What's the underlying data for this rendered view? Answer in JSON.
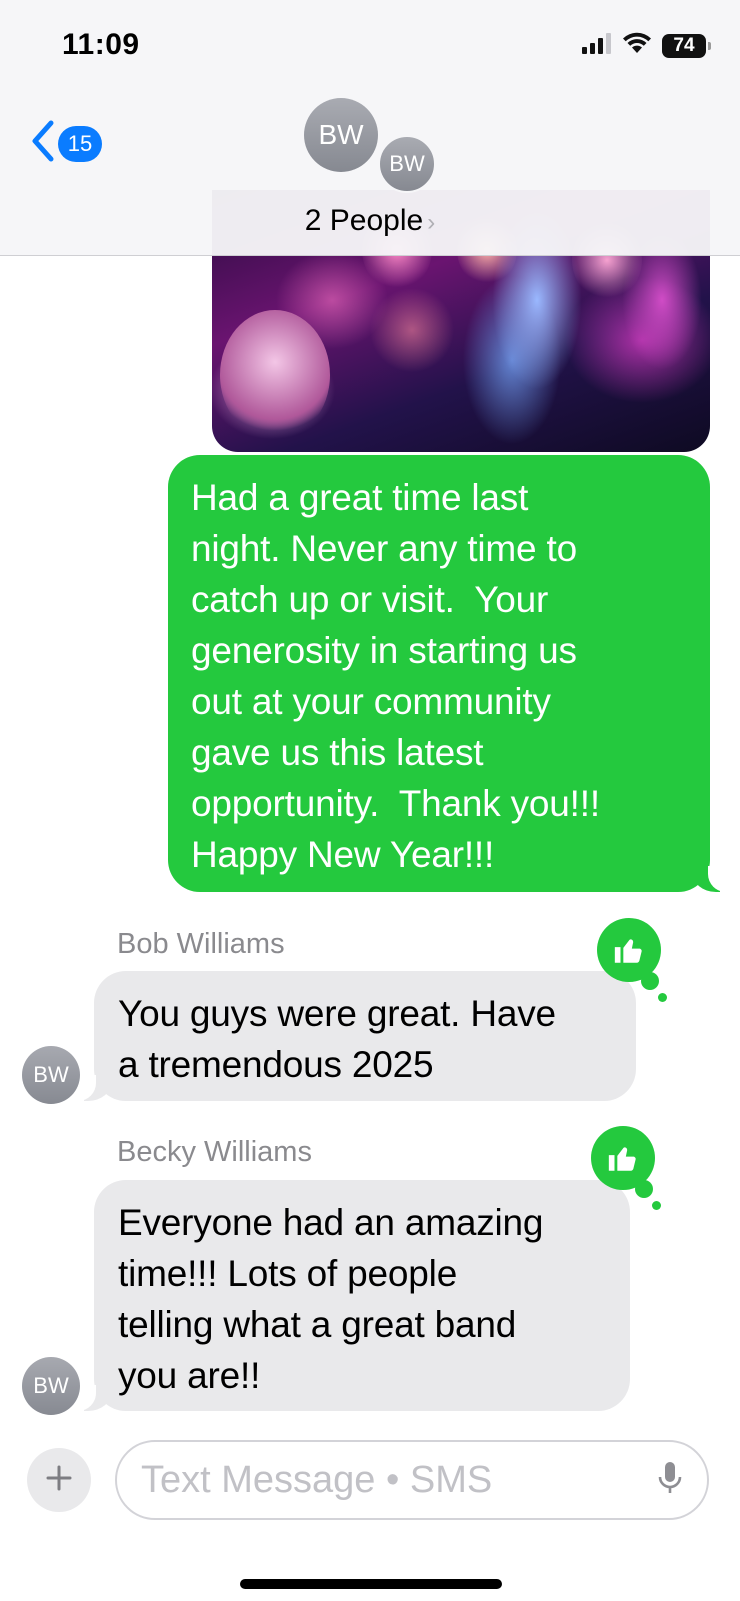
{
  "status_bar": {
    "time": "11:09",
    "battery": "74"
  },
  "header": {
    "unread_count": "15",
    "avatar_initials": "BW",
    "avatar_initials_2": "BW",
    "title": "2 People",
    "chevron": "›"
  },
  "messages": [
    {
      "type": "image",
      "direction": "sent",
      "description_icon": "photo-attachment"
    },
    {
      "type": "text",
      "direction": "sent",
      "lines": [
        "Had a great time last",
        "night. Never any time to",
        "catch up or visit.  Your",
        "generosity in starting us",
        "out at your community",
        "gave us this latest",
        "opportunity.  Thank you!!!",
        "Happy New Year!!!"
      ]
    },
    {
      "type": "text",
      "direction": "received",
      "sender": "Bob Williams",
      "avatar": "BW",
      "tapback": "thumbs-up-icon",
      "lines": [
        "You guys were great. Have",
        "a tremendous 2025"
      ]
    },
    {
      "type": "text",
      "direction": "received",
      "sender": "Becky Williams",
      "avatar": "BW",
      "tapback": "thumbs-up-icon",
      "lines": [
        "Everyone had an amazing",
        "time!!! Lots of people",
        "telling what a great band",
        "you are!!"
      ]
    }
  ],
  "input_bar": {
    "placeholder": "Text Message • SMS",
    "plus_icon": "plus-icon",
    "mic_icon": "microphone-icon"
  },
  "colors": {
    "sent_bubble": "#24c93e",
    "received_bubble": "#e9e9eb",
    "accent": "#0a7cff"
  }
}
